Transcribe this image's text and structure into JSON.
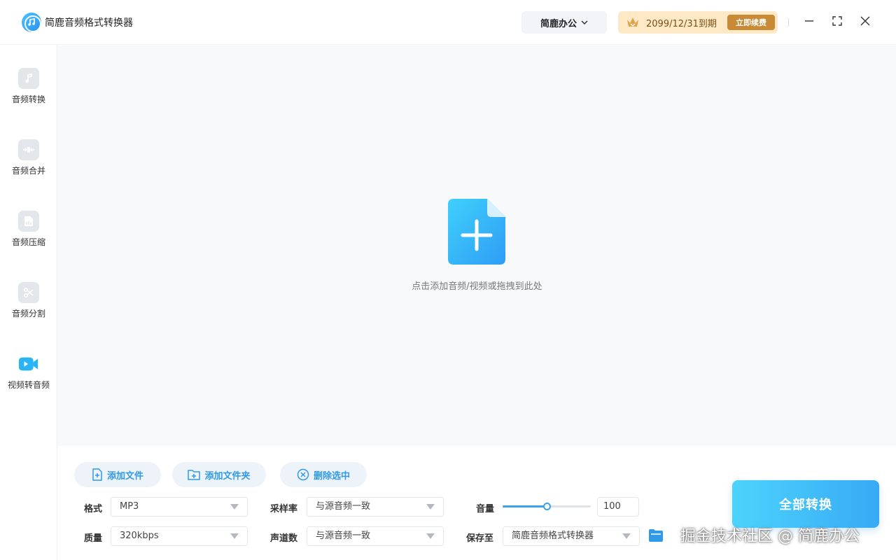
{
  "app": {
    "title": "简鹿音频格式转换器"
  },
  "header": {
    "org_label": "简鹿办公",
    "vip_expiry": "2099/12/31到期",
    "renew_label": "立即续费"
  },
  "sidebar": {
    "items": [
      {
        "label": "音频转换",
        "icon": "music-note-icon"
      },
      {
        "label": "音频合并",
        "icon": "merge-icon"
      },
      {
        "label": "音频压缩",
        "icon": "compress-icon"
      },
      {
        "label": "音频分割",
        "icon": "scissors-icon"
      },
      {
        "label": "视频转音频",
        "icon": "video-camera-icon",
        "active": true
      }
    ]
  },
  "main": {
    "drop_hint": "点击添加音频/视频或拖拽到此处"
  },
  "actions": {
    "add_file": "添加文件",
    "add_folder": "添加文件夹",
    "delete_selected": "删除选中"
  },
  "settings": {
    "format_label": "格式",
    "format_value": "MP3",
    "quality_label": "质量",
    "quality_value": "320kbps",
    "sample_rate_label": "采样率",
    "sample_rate_value": "与源音频一致",
    "channels_label": "声道数",
    "channels_value": "与源音频一致",
    "volume_label": "音量",
    "volume_value": "100",
    "volume_fraction": 0.5,
    "save_label": "保存至",
    "save_value": "简鹿音频格式转换器"
  },
  "convert_all": "全部转换",
  "watermark": "掘金技术社区 @ 简鹿办公",
  "colors": {
    "accent": "#37aaf6",
    "vip_bg": "#fde9c6",
    "renew": "#c98a36"
  }
}
